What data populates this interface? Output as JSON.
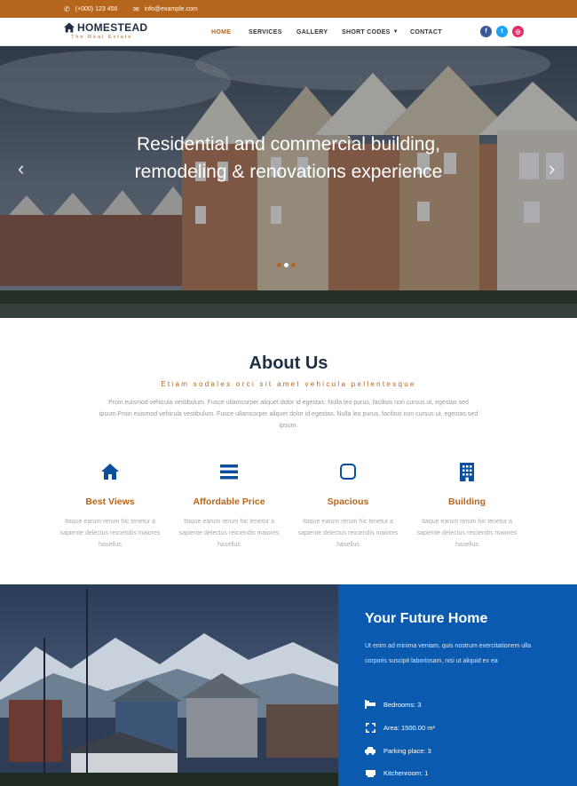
{
  "topbar": {
    "phone": "(+000) 123 456",
    "email": "info@example.com",
    "bg_color": "#b6661c"
  },
  "header": {
    "logo_name": "HOMESTEAD",
    "logo_tagline": "The Real Estate",
    "nav": [
      {
        "label": "HOME",
        "active": true
      },
      {
        "label": "SERVICES"
      },
      {
        "label": "GALLERY"
      },
      {
        "label": "SHORT CODES"
      },
      {
        "label": "CONTACT"
      }
    ],
    "social": [
      {
        "icon": "facebook-icon",
        "glyph": "f",
        "color": "#3b5998"
      },
      {
        "icon": "twitter-icon",
        "glyph": "t",
        "color": "#1da1f2"
      },
      {
        "icon": "instagram-icon",
        "glyph": "◎",
        "color": "#e1306c"
      }
    ]
  },
  "hero": {
    "line1": "Residential and commercial building,",
    "line2": "remodeling & renovations experience",
    "prev_glyph": "‹",
    "next_glyph": "›",
    "slides": 3,
    "active_slide": 2
  },
  "about": {
    "title": "About Us",
    "subtitle": "Etiam sodales orci sit amet vehicula pellentesque",
    "text": "Proin euismod vehicula vestibulum. Fusce ullamcorper aliquet dolor id egestas. Nulla leo purus, facilisis non cursus ut, egestas sed ipsum.Proin euismod vehicula vestibulum. Fusce ullamcorper aliquet dolor id egestas. Nulla leo purus, facilisis non cursus ut, egestas sed ipsum."
  },
  "features": [
    {
      "icon": "home-icon",
      "title": "Best Views",
      "text": "Itaque earum rerum hic tenetur a sapiente delectus reiciendis maiores hasellus"
    },
    {
      "icon": "bars-icon",
      "title": "Affordable Price",
      "text": "Itaque earum rerum hic tenetur a sapiente delectus reiciendis maiores hasellus"
    },
    {
      "icon": "square-icon",
      "title": "Spacious",
      "text": "Itaque earum rerum hic tenetur a sapiente delectus reiciendis maiores hasellus"
    },
    {
      "icon": "building-icon",
      "title": "Building",
      "text": "Itaque earum rerum hic tenetur a sapiente delectus reiciendis maiores hasellus"
    }
  ],
  "future_home": {
    "title": "Your Future Home",
    "text": "Ut enim ad minima veniam, quis nostrum exercitationem ulla corporis suscipit laboriosam, nisi ut aliquid ex ea",
    "panel_color": "#0a5bb0",
    "details": [
      {
        "icon": "bed-icon",
        "label": "Bedrooms: 3"
      },
      {
        "icon": "area-icon",
        "label": "Area: 1500.00 m²"
      },
      {
        "icon": "car-icon",
        "label": "Parking place: 3"
      },
      {
        "icon": "kitchen-icon",
        "label": "Kitchenroom: 1"
      }
    ]
  },
  "accent_color": "#b6661c",
  "heading_color": "#1e2e44"
}
